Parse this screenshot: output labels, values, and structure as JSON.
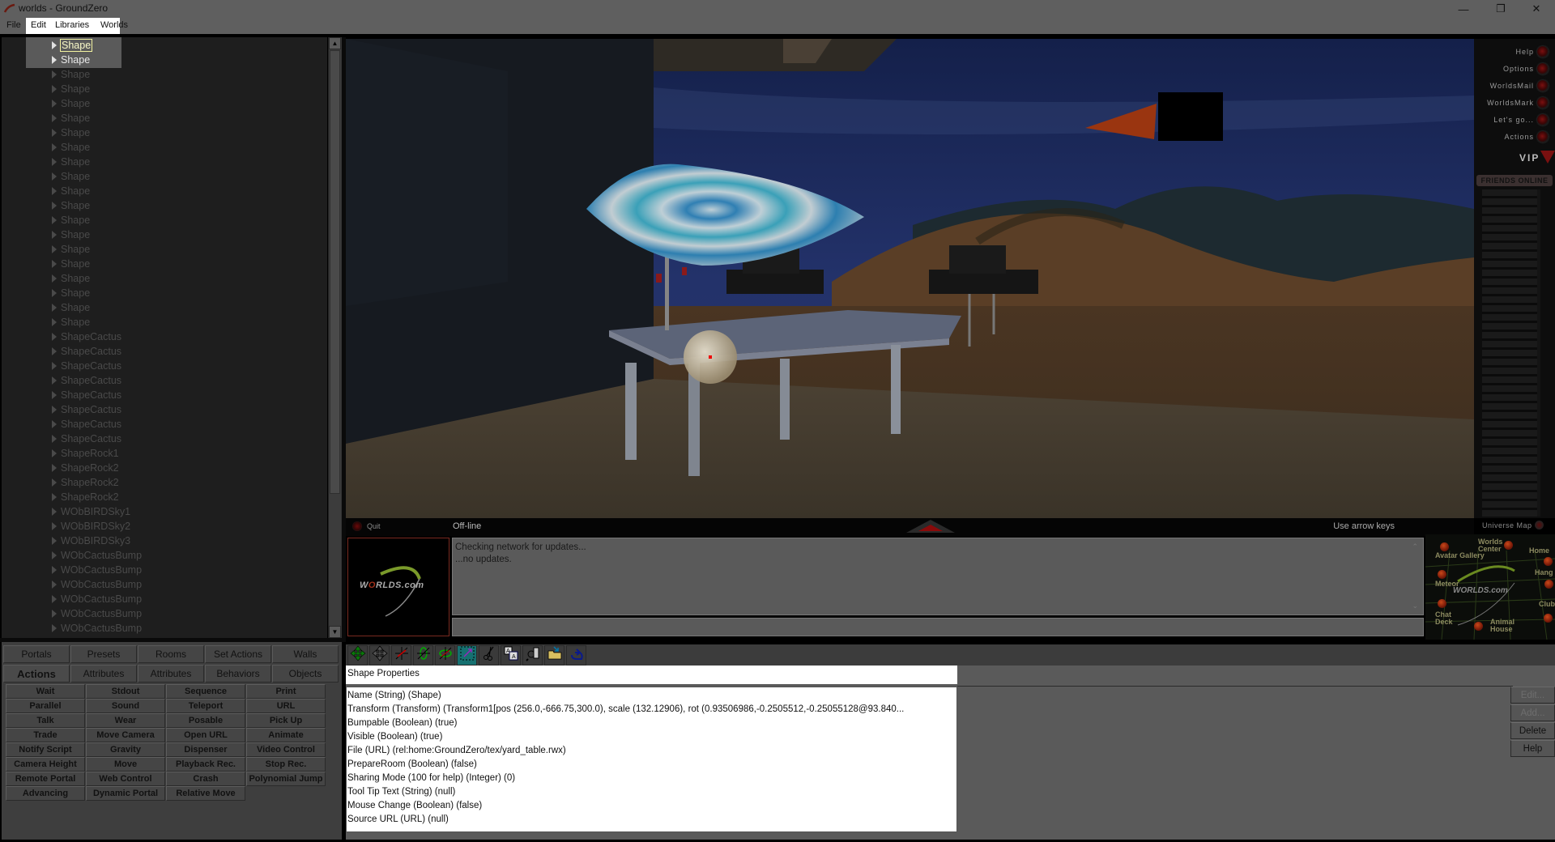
{
  "window": {
    "title": "worlds - GroundZero",
    "controls": {
      "minimize": "—",
      "maximize": "❐",
      "close": "✕"
    }
  },
  "menu": [
    "File",
    "Edit",
    "Libraries",
    "Worlds"
  ],
  "tree": {
    "items": [
      {
        "label": "Shape",
        "state": "selected"
      },
      {
        "label": "Shape",
        "state": "active"
      },
      {
        "label": "Shape"
      },
      {
        "label": "Shape"
      },
      {
        "label": "Shape"
      },
      {
        "label": "Shape"
      },
      {
        "label": "Shape"
      },
      {
        "label": "Shape"
      },
      {
        "label": "Shape"
      },
      {
        "label": "Shape"
      },
      {
        "label": "Shape"
      },
      {
        "label": "Shape"
      },
      {
        "label": "Shape"
      },
      {
        "label": "Shape"
      },
      {
        "label": "Shape"
      },
      {
        "label": "Shape"
      },
      {
        "label": "Shape"
      },
      {
        "label": "Shape"
      },
      {
        "label": "Shape"
      },
      {
        "label": "Shape"
      },
      {
        "label": "ShapeCactus"
      },
      {
        "label": "ShapeCactus"
      },
      {
        "label": "ShapeCactus"
      },
      {
        "label": "ShapeCactus"
      },
      {
        "label": "ShapeCactus"
      },
      {
        "label": "ShapeCactus"
      },
      {
        "label": "ShapeCactus"
      },
      {
        "label": "ShapeCactus"
      },
      {
        "label": "ShapeRock1"
      },
      {
        "label": "ShapeRock2"
      },
      {
        "label": "ShapeRock2"
      },
      {
        "label": "ShapeRock2"
      },
      {
        "label": "WObBIRDSky1"
      },
      {
        "label": "WObBIRDSky2"
      },
      {
        "label": "WObBIRDSky3"
      },
      {
        "label": "WObCactusBump"
      },
      {
        "label": "WObCactusBump"
      },
      {
        "label": "WObCactusBump"
      },
      {
        "label": "WObCactusBump"
      },
      {
        "label": "WObCactusBump"
      },
      {
        "label": "WObCactusBump"
      }
    ]
  },
  "side_menu": {
    "items": [
      "Help",
      "Options",
      "WorldsMail",
      "WorldsMark",
      "Let's go...",
      "Actions"
    ],
    "vip": "VIP",
    "friends_header": "FRIENDS ONLINE"
  },
  "status": {
    "quit": "Quit",
    "connection": "Off-line",
    "hint": "Use arrow keys",
    "universe_map": "Universe Map"
  },
  "logo": {
    "text_a": "W",
    "text_o": "O",
    "text_b": "RLDS",
    "text_c": ".com"
  },
  "chat": {
    "lines": [
      "Checking network for updates...",
      "...no updates."
    ],
    "input_value": ""
  },
  "universe_map": {
    "locations": [
      "Avatar Gallery",
      "Worlds Center",
      "Home",
      "Hang",
      "Meteor",
      "Club",
      "Chat Deck",
      "Animal House"
    ],
    "logo": "WORLDS.com"
  },
  "tabs": {
    "row1": [
      "Portals",
      "Presets",
      "Rooms",
      "Set Actions",
      "Walls"
    ],
    "row2": [
      "Actions",
      "Attributes",
      "Attributes",
      "Behaviors",
      "Objects"
    ],
    "active": "Actions"
  },
  "actions": [
    [
      "Wait",
      "Stdout",
      "Sequence",
      "Print"
    ],
    [
      "Parallel",
      "Sound",
      "Teleport",
      "URL"
    ],
    [
      "Talk",
      "Wear",
      "Posable",
      "Pick Up"
    ],
    [
      "Trade",
      "Move Camera",
      "Open URL",
      "Animate"
    ],
    [
      "Notify Script",
      "Gravity",
      "Dispenser",
      "Video Control"
    ],
    [
      "Camera Height",
      "Move",
      "Playback Rec.",
      "Stop Rec."
    ],
    [
      "Remote Portal",
      "Web Control",
      "Crash",
      "Polynomial Jump"
    ],
    [
      "Advancing",
      "Dynamic Portal",
      "Relative Move"
    ]
  ],
  "toolbar": {
    "tools": [
      "move-xy-icon",
      "move-all-icon",
      "rotate-x-icon",
      "rotate-y-icon",
      "rotate-z-icon",
      "scale-icon",
      "cut-icon",
      "copy-icon",
      "inspect-icon",
      "open-folder-icon",
      "undo-icon"
    ],
    "active_index": 5
  },
  "properties": {
    "title": "Shape Properties",
    "rows": [
      "Name (String) (Shape)",
      "Transform (Transform) (Transform1[pos (256.0,-666.75,300.0), scale (132.12906), rot (0.93506986,-0.2505512,-0.25055128@93.840...",
      "Bumpable (Boolean) (true)",
      "Visible (Boolean) (true)",
      "File (URL) (rel:home:GroundZero/tex/yard_table.rwx)",
      "PrepareRoom (Boolean) (false)",
      "Sharing Mode (100 for help) (Integer) (0)",
      "Tool Tip Text (String) (null)",
      "Mouse Change (Boolean) (false)",
      "Source URL (URL) (null)"
    ],
    "buttons": [
      {
        "label": "Edit...",
        "enabled": false
      },
      {
        "label": "Add...",
        "enabled": false
      },
      {
        "label": "Delete",
        "enabled": true
      },
      {
        "label": "Help",
        "enabled": true
      }
    ]
  },
  "colors": {
    "chrome": "#5f5f5f",
    "tree_bg": "#1e1e1e",
    "selection_outline": "#f2f2a0",
    "active_tool": "#167070",
    "sky": "#1b2a55",
    "accent_red": "#7a1010"
  }
}
